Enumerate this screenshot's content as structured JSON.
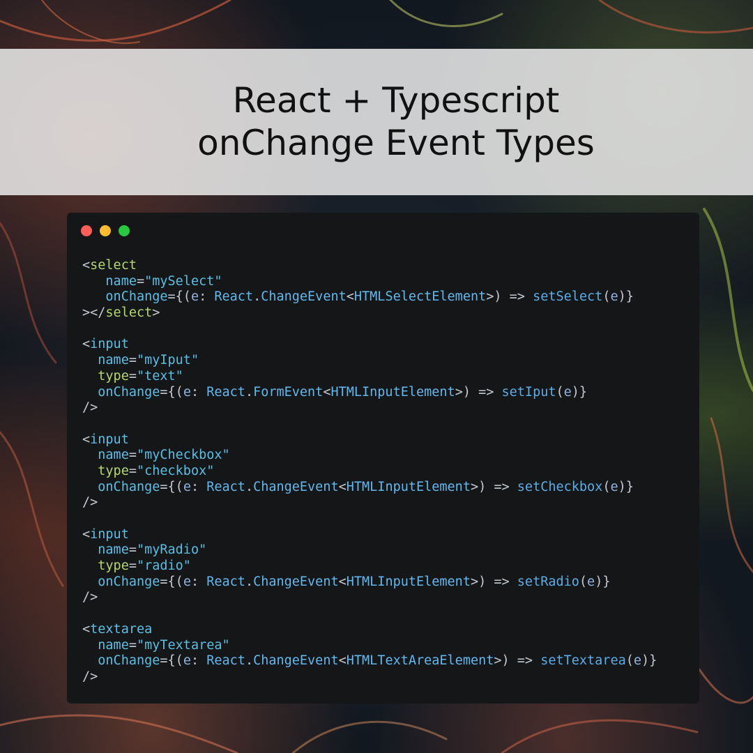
{
  "colors": {
    "banner_bg": "#ebebeb",
    "window_bg": "#151618",
    "dot_red": "#ff5f57",
    "dot_yellow": "#febc2e",
    "dot_green": "#28c840",
    "tag": "#b5d86e",
    "attr": "#5cc0e6",
    "string": "#59bfe3",
    "punct": "#c6cbd3"
  },
  "banner": {
    "title_line1": "React + Typescript",
    "title_line2": "onChange Event Types"
  },
  "window": {
    "controls": [
      "close",
      "minimize",
      "maximize"
    ]
  },
  "code": {
    "lines": [
      [
        {
          "t": "<",
          "c": "punct"
        },
        {
          "t": "select",
          "c": "tag"
        }
      ],
      [
        {
          "t": "   ",
          "c": "punct"
        },
        {
          "t": "name",
          "c": "attr"
        },
        {
          "t": "=",
          "c": "punct"
        },
        {
          "t": "\"mySelect\"",
          "c": "str"
        }
      ],
      [
        {
          "t": "   ",
          "c": "punct"
        },
        {
          "t": "onChange",
          "c": "attr"
        },
        {
          "t": "={(",
          "c": "punct"
        },
        {
          "t": "e",
          "c": "param"
        },
        {
          "t": ": ",
          "c": "punct"
        },
        {
          "t": "React",
          "c": "type"
        },
        {
          "t": ".",
          "c": "punct"
        },
        {
          "t": "ChangeEvent",
          "c": "type"
        },
        {
          "t": "<",
          "c": "punct"
        },
        {
          "t": "HTMLSelectElement",
          "c": "type"
        },
        {
          "t": ">) => ",
          "c": "punct"
        },
        {
          "t": "setSelect",
          "c": "fn"
        },
        {
          "t": "(",
          "c": "punct"
        },
        {
          "t": "e",
          "c": "param"
        },
        {
          "t": ")}",
          "c": "punct"
        }
      ],
      [
        {
          "t": "></",
          "c": "punct"
        },
        {
          "t": "select",
          "c": "tag"
        },
        {
          "t": ">",
          "c": "punct"
        }
      ],
      [],
      [
        {
          "t": "<",
          "c": "punct"
        },
        {
          "t": "input",
          "c": "attr"
        }
      ],
      [
        {
          "t": "  ",
          "c": "punct"
        },
        {
          "t": "name",
          "c": "attr"
        },
        {
          "t": "=",
          "c": "punct"
        },
        {
          "t": "\"myIput\"",
          "c": "str"
        }
      ],
      [
        {
          "t": "  ",
          "c": "punct"
        },
        {
          "t": "type",
          "c": "tag"
        },
        {
          "t": "=",
          "c": "punct"
        },
        {
          "t": "\"text\"",
          "c": "str"
        }
      ],
      [
        {
          "t": "  ",
          "c": "punct"
        },
        {
          "t": "onChange",
          "c": "attr"
        },
        {
          "t": "={(",
          "c": "punct"
        },
        {
          "t": "e",
          "c": "param"
        },
        {
          "t": ": ",
          "c": "punct"
        },
        {
          "t": "React",
          "c": "type"
        },
        {
          "t": ".",
          "c": "punct"
        },
        {
          "t": "FormEvent",
          "c": "type"
        },
        {
          "t": "<",
          "c": "punct"
        },
        {
          "t": "HTMLInputElement",
          "c": "type"
        },
        {
          "t": ">) => ",
          "c": "punct"
        },
        {
          "t": "setIput",
          "c": "fn"
        },
        {
          "t": "(",
          "c": "punct"
        },
        {
          "t": "e",
          "c": "param"
        },
        {
          "t": ")}",
          "c": "punct"
        }
      ],
      [
        {
          "t": "/>",
          "c": "punct"
        }
      ],
      [],
      [
        {
          "t": "<",
          "c": "punct"
        },
        {
          "t": "input",
          "c": "attr"
        }
      ],
      [
        {
          "t": "  ",
          "c": "punct"
        },
        {
          "t": "name",
          "c": "attr"
        },
        {
          "t": "=",
          "c": "punct"
        },
        {
          "t": "\"myCheckbox\"",
          "c": "str"
        }
      ],
      [
        {
          "t": "  ",
          "c": "punct"
        },
        {
          "t": "type",
          "c": "tag"
        },
        {
          "t": "=",
          "c": "punct"
        },
        {
          "t": "\"checkbox\"",
          "c": "str"
        }
      ],
      [
        {
          "t": "  ",
          "c": "punct"
        },
        {
          "t": "onChange",
          "c": "attr"
        },
        {
          "t": "={(",
          "c": "punct"
        },
        {
          "t": "e",
          "c": "param"
        },
        {
          "t": ": ",
          "c": "punct"
        },
        {
          "t": "React",
          "c": "type"
        },
        {
          "t": ".",
          "c": "punct"
        },
        {
          "t": "ChangeEvent",
          "c": "type"
        },
        {
          "t": "<",
          "c": "punct"
        },
        {
          "t": "HTMLInputElement",
          "c": "type"
        },
        {
          "t": ">) => ",
          "c": "punct"
        },
        {
          "t": "setCheckbox",
          "c": "fn"
        },
        {
          "t": "(",
          "c": "punct"
        },
        {
          "t": "e",
          "c": "param"
        },
        {
          "t": ")}",
          "c": "punct"
        }
      ],
      [
        {
          "t": "/>",
          "c": "punct"
        }
      ],
      [],
      [
        {
          "t": "<",
          "c": "punct"
        },
        {
          "t": "input",
          "c": "attr"
        }
      ],
      [
        {
          "t": "  ",
          "c": "punct"
        },
        {
          "t": "name",
          "c": "attr"
        },
        {
          "t": "=",
          "c": "punct"
        },
        {
          "t": "\"myRadio\"",
          "c": "str"
        }
      ],
      [
        {
          "t": "  ",
          "c": "punct"
        },
        {
          "t": "type",
          "c": "tag"
        },
        {
          "t": "=",
          "c": "punct"
        },
        {
          "t": "\"radio\"",
          "c": "str"
        }
      ],
      [
        {
          "t": "  ",
          "c": "punct"
        },
        {
          "t": "onChange",
          "c": "attr"
        },
        {
          "t": "={(",
          "c": "punct"
        },
        {
          "t": "e",
          "c": "param"
        },
        {
          "t": ": ",
          "c": "punct"
        },
        {
          "t": "React",
          "c": "type"
        },
        {
          "t": ".",
          "c": "punct"
        },
        {
          "t": "ChangeEvent",
          "c": "type"
        },
        {
          "t": "<",
          "c": "punct"
        },
        {
          "t": "HTMLInputElement",
          "c": "type"
        },
        {
          "t": ">) => ",
          "c": "punct"
        },
        {
          "t": "setRadio",
          "c": "fn"
        },
        {
          "t": "(",
          "c": "punct"
        },
        {
          "t": "e",
          "c": "param"
        },
        {
          "t": ")}",
          "c": "punct"
        }
      ],
      [
        {
          "t": "/>",
          "c": "punct"
        }
      ],
      [],
      [
        {
          "t": "<",
          "c": "punct"
        },
        {
          "t": "textarea",
          "c": "attr"
        }
      ],
      [
        {
          "t": "  ",
          "c": "punct"
        },
        {
          "t": "name",
          "c": "attr"
        },
        {
          "t": "=",
          "c": "punct"
        },
        {
          "t": "\"myTextarea\"",
          "c": "str"
        }
      ],
      [
        {
          "t": "  ",
          "c": "punct"
        },
        {
          "t": "onChange",
          "c": "attr"
        },
        {
          "t": "={(",
          "c": "punct"
        },
        {
          "t": "e",
          "c": "param"
        },
        {
          "t": ": ",
          "c": "punct"
        },
        {
          "t": "React",
          "c": "type"
        },
        {
          "t": ".",
          "c": "punct"
        },
        {
          "t": "ChangeEvent",
          "c": "type"
        },
        {
          "t": "<",
          "c": "punct"
        },
        {
          "t": "HTMLTextAreaElement",
          "c": "type"
        },
        {
          "t": ">) => ",
          "c": "punct"
        },
        {
          "t": "setTextarea",
          "c": "fn"
        },
        {
          "t": "(",
          "c": "punct"
        },
        {
          "t": "e",
          "c": "param"
        },
        {
          "t": ")}",
          "c": "punct"
        }
      ],
      [
        {
          "t": "/>",
          "c": "punct"
        }
      ]
    ]
  }
}
